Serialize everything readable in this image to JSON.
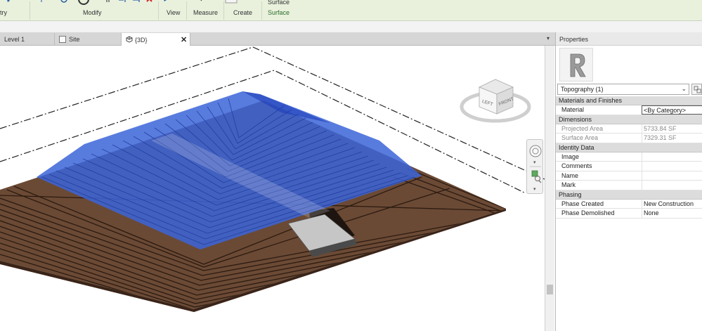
{
  "ribbon": {
    "geometry_label": "try",
    "modify_label": "Modify",
    "view_label": "View",
    "measure_label": "Measure",
    "create_label": "Create",
    "surface_top": "Surface",
    "surface_label": "Surface"
  },
  "tabs": [
    {
      "label": "Level 1"
    },
    {
      "label": "Site"
    },
    {
      "label": "{3D}",
      "active": true,
      "close": "✕"
    }
  ],
  "viewcube": {
    "left": "LEFT",
    "front": "FRONT"
  },
  "properties": {
    "title": "Properties",
    "type_name": "Topography (1)",
    "groups": [
      {
        "name": "Materials and Finishes",
        "rows": [
          {
            "key": "Material",
            "value": "<By Category>",
            "readonly": false
          }
        ]
      },
      {
        "name": "Dimensions",
        "rows": [
          {
            "key": "Projected Area",
            "value": "5733.84 SF",
            "readonly": true
          },
          {
            "key": "Surface Area",
            "value": "7329.31 SF",
            "readonly": true
          }
        ]
      },
      {
        "name": "Identity Data",
        "rows": [
          {
            "key": "Image",
            "value": "",
            "readonly": false
          },
          {
            "key": "Comments",
            "value": "",
            "readonly": false
          },
          {
            "key": "Name",
            "value": "",
            "readonly": false
          },
          {
            "key": "Mark",
            "value": "",
            "readonly": false
          }
        ]
      },
      {
        "name": "Phasing",
        "rows": [
          {
            "key": "Phase Created",
            "value": "New Construction",
            "readonly": false
          },
          {
            "key": "Phase Demolished",
            "value": "None",
            "readonly": false
          }
        ]
      }
    ]
  },
  "colors": {
    "ribbon_bg": "#e9f1dd",
    "surface_blue": "#3b64d8",
    "earth_brown": "#6b4a35",
    "road_grey": "#c6c6c6"
  }
}
